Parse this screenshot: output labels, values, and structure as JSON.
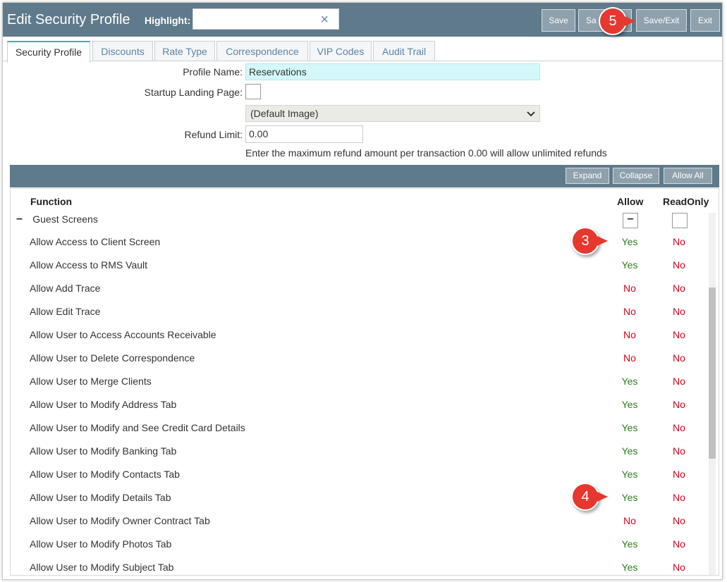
{
  "header": {
    "title": "Edit Security Profile",
    "highlight_label": "Highlight:",
    "highlight_value": "",
    "clear_glyph": "×",
    "buttons": {
      "save": "Save",
      "save2": "Sa",
      "save_exit": "Save/Exit",
      "exit": "Exit"
    }
  },
  "tabs": [
    "Security Profile",
    "Discounts",
    "Rate Type",
    "Correspondence",
    "VIP Codes",
    "Audit Trail"
  ],
  "form": {
    "profile_name_label": "Profile Name:",
    "profile_name_value": "Reservations",
    "startup_label": "Startup Landing Page:",
    "image_select": "(Default Image)",
    "refund_label": "Refund Limit:",
    "refund_value": "0.00",
    "refund_hint": "Enter the maximum refund amount per transaction 0.00 will allow unlimited refunds"
  },
  "grid_toolbar": {
    "expand": "Expand",
    "collapse": "Collapse",
    "allow_all": "Allow All"
  },
  "grid": {
    "col_function": "Function",
    "col_allow": "Allow",
    "col_readonly": "ReadOnly",
    "group_toggle": "−",
    "group_name": "Guest Screens",
    "group_allow_state": "−",
    "rows": [
      {
        "label": "Allow Access to Client Screen",
        "allow": "Yes",
        "readonly": "No"
      },
      {
        "label": "Allow Access to RMS Vault",
        "allow": "Yes",
        "readonly": "No"
      },
      {
        "label": "Allow Add Trace",
        "allow": "No",
        "readonly": "No"
      },
      {
        "label": "Allow Edit Trace",
        "allow": "No",
        "readonly": "No"
      },
      {
        "label": "Allow User to Access Accounts Receivable",
        "allow": "No",
        "readonly": "No"
      },
      {
        "label": "Allow User to Delete Correspondence",
        "allow": "No",
        "readonly": "No"
      },
      {
        "label": "Allow User to Merge Clients",
        "allow": "Yes",
        "readonly": "No"
      },
      {
        "label": "Allow User to Modify Address Tab",
        "allow": "Yes",
        "readonly": "No"
      },
      {
        "label": "Allow User to Modify and See Credit Card Details",
        "allow": "Yes",
        "readonly": "No"
      },
      {
        "label": "Allow User to Modify Banking Tab",
        "allow": "Yes",
        "readonly": "No"
      },
      {
        "label": "Allow User to Modify Contacts Tab",
        "allow": "Yes",
        "readonly": "No"
      },
      {
        "label": "Allow User to Modify Details Tab",
        "allow": "Yes",
        "readonly": "No"
      },
      {
        "label": "Allow User to Modify Owner Contract Tab",
        "allow": "No",
        "readonly": "No"
      },
      {
        "label": "Allow User to Modify Photos Tab",
        "allow": "Yes",
        "readonly": "No"
      },
      {
        "label": "Allow User to Modify Subject Tab",
        "allow": "Yes",
        "readonly": "No"
      }
    ]
  },
  "callouts": [
    "5",
    "3",
    "4"
  ],
  "colors": {
    "toolbar": "#5e7a8b",
    "button": "#8ea1ad",
    "yes": "#2e7d1e",
    "no": "#d9001b",
    "callout": "#e6382f",
    "name_field": "#d4f7fa"
  }
}
